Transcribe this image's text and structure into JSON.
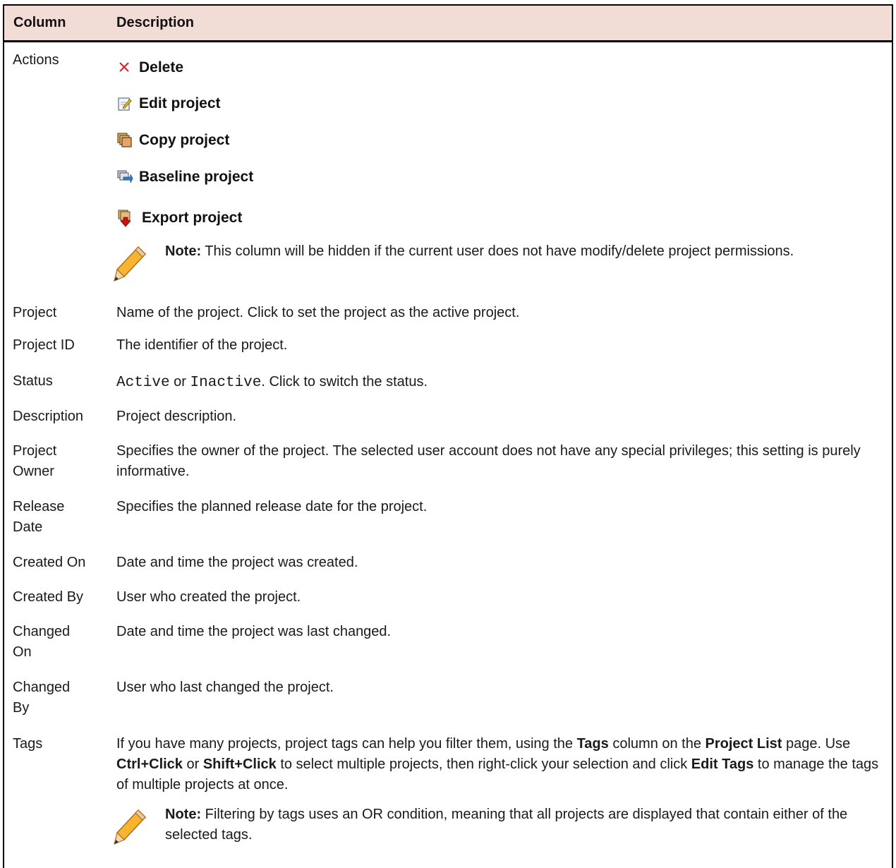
{
  "header": {
    "column": "Column",
    "description": "Description"
  },
  "actions_row": {
    "label": "Actions",
    "items": [
      {
        "icon": "delete-x-icon",
        "label": "Delete"
      },
      {
        "icon": "edit-icon",
        "label": "Edit project"
      },
      {
        "icon": "copy-icon",
        "label": "Copy project"
      },
      {
        "icon": "baseline-icon",
        "label": "Baseline project"
      },
      {
        "icon": "export-icon",
        "label": "Export project"
      }
    ],
    "note": {
      "label": "Note:",
      "text": " This column will be hidden if the current user does not have modify/delete project permissions."
    }
  },
  "rows": {
    "project": {
      "label": "Project",
      "desc": "Name of the project. Click to set the project as the active project."
    },
    "project_id": {
      "label": "Project ID",
      "desc": "The identifier of the project."
    },
    "status": {
      "label": "Status",
      "active": "Active",
      "or": " or ",
      "inactive": "Inactive",
      "rest": ". Click to switch the status."
    },
    "description": {
      "label": "Description",
      "desc": "Project description."
    },
    "project_owner": {
      "label_1": "Project",
      "label_2": "Owner",
      "desc": "Specifies the owner of the project. The selected user account does not have any special privileges; this setting is purely informative."
    },
    "release_date": {
      "label_1": "Release",
      "label_2": "Date",
      "desc": "Specifies the planned release date for the project."
    },
    "created_on": {
      "label": "Created On",
      "desc": "Date and time the project was created."
    },
    "created_by": {
      "label": "Created By",
      "desc": "User who created the project."
    },
    "changed_on": {
      "label_1": "Changed",
      "label_2": "On",
      "desc": "Date and time the project was last changed."
    },
    "changed_by": {
      "label_1": "Changed",
      "label_2": "By",
      "desc": "User who last changed the project."
    },
    "tags": {
      "label": "Tags",
      "p1": "If you have many projects, project tags can help you filter them, using the ",
      "b1": "Tags",
      "p2": " column on the ",
      "b2": "Project List",
      "p3": " page. Use ",
      "b3": "Ctrl+Click",
      "p4": " or ",
      "b4": "Shift+Click",
      "p5": " to select multiple projects, then right-click your selection and click ",
      "b5": "Edit Tags",
      "p6": " to manage the tags of multiple projects at once.",
      "note_label": "Note:",
      "note_text": " Filtering by tags uses an OR condition, meaning that all projects are displayed that contain either of the selected tags."
    }
  },
  "colors": {
    "header_bg": "#f1ddd6",
    "delete_red": "#e02020",
    "export_red": "#cc1111"
  }
}
